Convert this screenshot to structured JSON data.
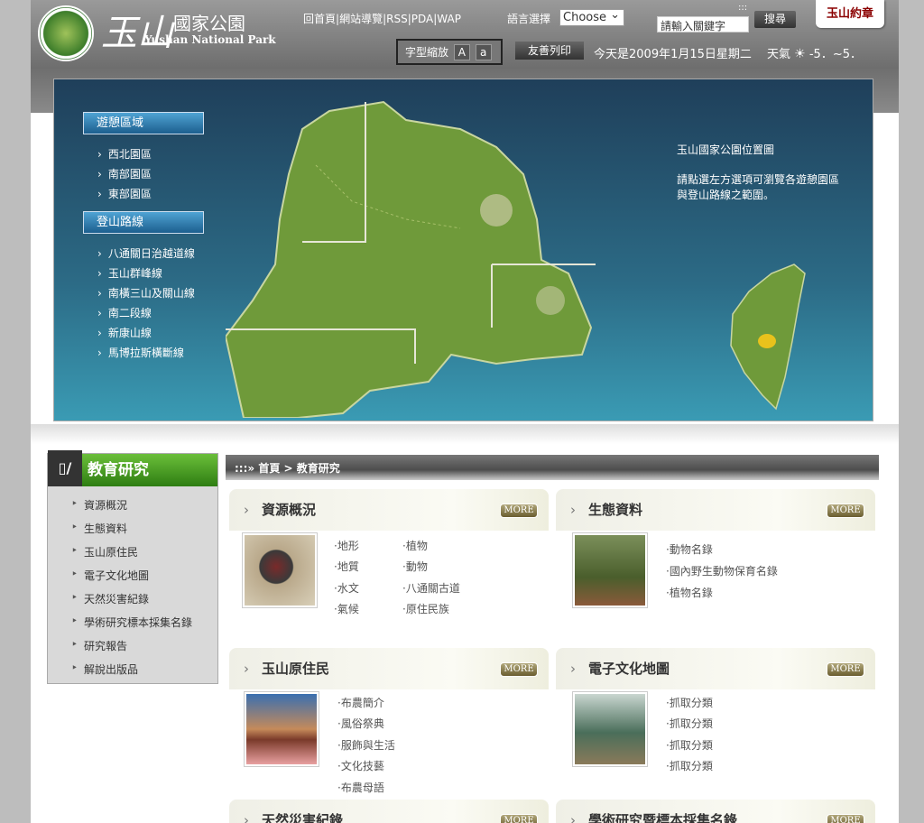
{
  "header": {
    "brand_char": "玉山",
    "brand_cn": "國家公園",
    "brand_en": "Yushan National Park",
    "links": [
      "回首頁",
      "網站導覽",
      "RSS",
      "PDA",
      "WAP"
    ],
    "sep": "|",
    "lang_label": "語言選擇",
    "lang_value": "Choose",
    "search_dots": ":::",
    "search_placeholder": "請輸入關鍵字",
    "search_button": "搜尋",
    "stamp_tab": "玉山約章",
    "fontsize_label": "字型縮放",
    "font_large": "A",
    "font_small": "a",
    "print_button": "友善列印",
    "date": "今天是2009年1月15日星期二",
    "weather_label": "天氣",
    "weather_value": "-5．~5．"
  },
  "hero": {
    "menu_area_title": "遊憩區域",
    "areas": [
      "西北園區",
      "南部園區",
      "東部園區"
    ],
    "menu_route_title": "登山路線",
    "routes": [
      "八通關日治越道線",
      "玉山群峰線",
      "南橫三山及關山線",
      "南二段線",
      "新康山線",
      "馬博拉斯橫斷線"
    ],
    "info_title": "玉山國家公園位置圖",
    "info_text1": "請點選左方選項可瀏覽各遊憩園區",
    "info_text2": "與登山路線之範圍。"
  },
  "sidebar": {
    "title": "教育研究",
    "items": [
      "資源概況",
      "生態資料",
      "玉山原住民",
      "電子文化地圖",
      "天然災害紀錄",
      "學術研究標本採集名錄",
      "研究報告",
      "解說出版品"
    ]
  },
  "breadcrumb": {
    "prefix": ":::»",
    "home": "首頁",
    "arrow": ">",
    "current": "教育研究"
  },
  "cards": [
    {
      "title": "資源概況",
      "more": "MORE",
      "col1": [
        "地形",
        "地質",
        "水文",
        "氣候"
      ],
      "col2": [
        "植物",
        "動物",
        "八通關古道",
        "原住民族"
      ]
    },
    {
      "title": "生態資料",
      "more": "MORE",
      "col1": [
        "動物名錄",
        "國內野生動物保育名錄",
        "植物名錄"
      ]
    },
    {
      "title": "玉山原住民",
      "more": "MORE",
      "col1": [
        "布農簡介",
        "風俗祭典",
        "服飾與生活",
        "文化技藝",
        "布農母語"
      ]
    },
    {
      "title": "電子文化地圖",
      "more": "MORE",
      "col1": [
        "抓取分類",
        "抓取分類",
        "抓取分類",
        "抓取分類"
      ]
    },
    {
      "title": "天然災害紀錄",
      "more": "MORE"
    },
    {
      "title": "學術研究暨標本採集名錄",
      "more": "MORE"
    }
  ]
}
